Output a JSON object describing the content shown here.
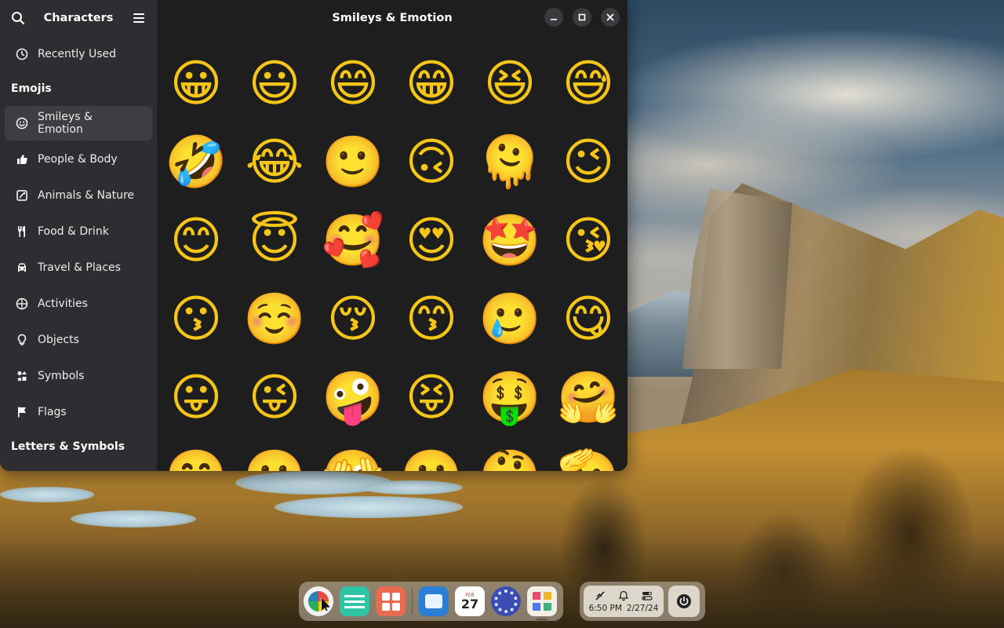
{
  "sidebar": {
    "title": "Characters",
    "recently_used": "Recently Used",
    "section_emojis": "Emojis",
    "items": [
      {
        "label": "Smileys & Emotion",
        "icon": "smiley-icon",
        "active": true
      },
      {
        "label": "People & Body",
        "icon": "thumbs-up-icon"
      },
      {
        "label": "Animals & Nature",
        "icon": "paw-icon"
      },
      {
        "label": "Food & Drink",
        "icon": "cutlery-icon"
      },
      {
        "label": "Travel & Places",
        "icon": "car-icon"
      },
      {
        "label": "Activities",
        "icon": "ball-icon"
      },
      {
        "label": "Objects",
        "icon": "lightbulb-icon"
      },
      {
        "label": "Symbols",
        "icon": "symbols-icon"
      },
      {
        "label": "Flags",
        "icon": "flag-icon"
      }
    ],
    "section_letters": "Letters & Symbols"
  },
  "window": {
    "title": "Smileys & Emotion",
    "controls": [
      "minimize",
      "maximize",
      "close"
    ]
  },
  "emojis": [
    "😀",
    "😃",
    "😄",
    "😁",
    "😆",
    "😅",
    "🤣",
    "😂",
    "🙂",
    "🙃",
    "🫠",
    "😉",
    "😊",
    "😇",
    "🥰",
    "😍",
    "🤩",
    "😘",
    "😗",
    "☺️",
    "😚",
    "😙",
    "🥲",
    "😋",
    "😛",
    "😜",
    "🤪",
    "😝",
    "🤑",
    "🤗",
    "🤭",
    "🫢",
    "🫣",
    "🤫",
    "🤔",
    "🫡"
  ],
  "dock": {
    "calendar_month": "FEB",
    "calendar_day": "27"
  },
  "tray": {
    "time": "6:50 PM",
    "date": "2/27/24"
  }
}
